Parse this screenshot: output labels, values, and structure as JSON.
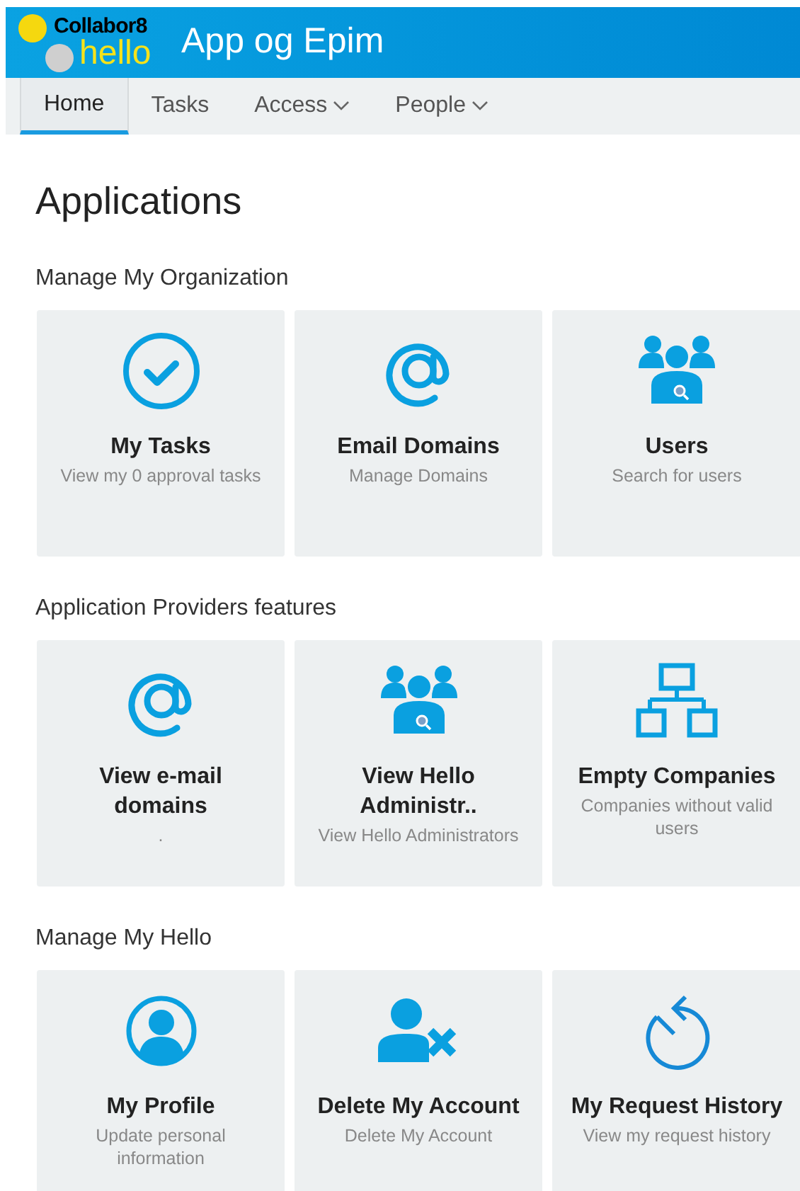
{
  "header": {
    "logo_top": "Collabor8",
    "logo_bottom": "hello",
    "title": "App og Epim"
  },
  "nav": [
    {
      "label": "Home",
      "selected": true,
      "dropdown": false
    },
    {
      "label": "Tasks",
      "selected": false,
      "dropdown": false
    },
    {
      "label": "Access",
      "selected": false,
      "dropdown": true
    },
    {
      "label": "People",
      "selected": false,
      "dropdown": true
    }
  ],
  "page_title": "Applications",
  "sections": [
    {
      "title": "Manage My Organization",
      "tiles": [
        {
          "kind": "check",
          "title": "My Tasks",
          "description": "View my 0 approval tasks"
        },
        {
          "kind": "at",
          "title": "Email Domains",
          "description": "Manage Domains"
        },
        {
          "kind": "users",
          "title": "Users",
          "description": "Search for users"
        }
      ]
    },
    {
      "title": "Application Providers features",
      "tiles": [
        {
          "kind": "at",
          "title": "View e-mail\ndomains",
          "description": "."
        },
        {
          "kind": "users",
          "title": "View Hello\nAdministr..",
          "description": "View Hello Administrators"
        },
        {
          "kind": "org",
          "title": "Empty Companies",
          "description": "Companies without valid\nusers"
        }
      ]
    },
    {
      "title": "Manage My Hello",
      "tiles": [
        {
          "kind": "profile",
          "title": "My Profile",
          "description": "Update personal\ninformation"
        },
        {
          "kind": "userx",
          "title": "Delete My Account",
          "description": "Delete My Account"
        },
        {
          "kind": "history",
          "title": "My Request History",
          "description": "View my request history"
        }
      ]
    }
  ]
}
